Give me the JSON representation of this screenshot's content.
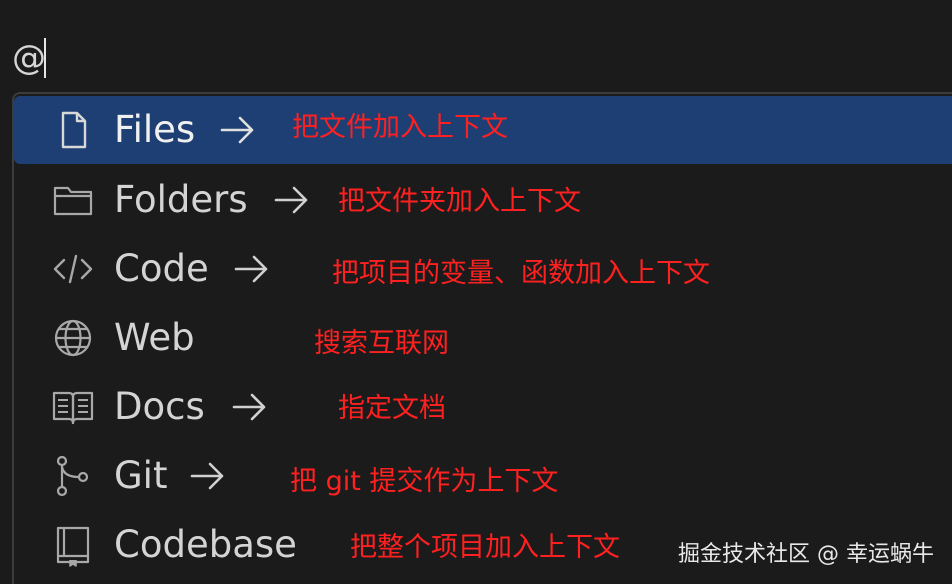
{
  "input": {
    "value": "@"
  },
  "menu": {
    "items": [
      {
        "label": "Files",
        "icon": "file-icon",
        "has_arrow": true,
        "active": true,
        "annotation": "把文件加入上下文"
      },
      {
        "label": "Folders",
        "icon": "folder-icon",
        "has_arrow": true,
        "active": false,
        "annotation": "把文件夹加入上下文"
      },
      {
        "label": "Code",
        "icon": "code-icon",
        "has_arrow": true,
        "active": false,
        "annotation": "把项目的变量、函数加入上下文"
      },
      {
        "label": "Web",
        "icon": "globe-icon",
        "has_arrow": false,
        "active": false,
        "annotation": "搜索互联网"
      },
      {
        "label": "Docs",
        "icon": "book-icon",
        "has_arrow": true,
        "active": false,
        "annotation": "指定文档"
      },
      {
        "label": "Git",
        "icon": "git-branch-icon",
        "has_arrow": true,
        "active": false,
        "annotation": "把 git 提交作为上下文"
      },
      {
        "label": "Codebase",
        "icon": "codebase-icon",
        "has_arrow": false,
        "active": false,
        "annotation": "把整个项目加入上下文"
      }
    ]
  },
  "watermark": "掘金技术社区 @ 幸运蜗牛",
  "colors": {
    "background": "#1b1b1c",
    "active_row": "#1d3f73",
    "label": "#d4d4d4",
    "annotation": "#ff2020"
  }
}
